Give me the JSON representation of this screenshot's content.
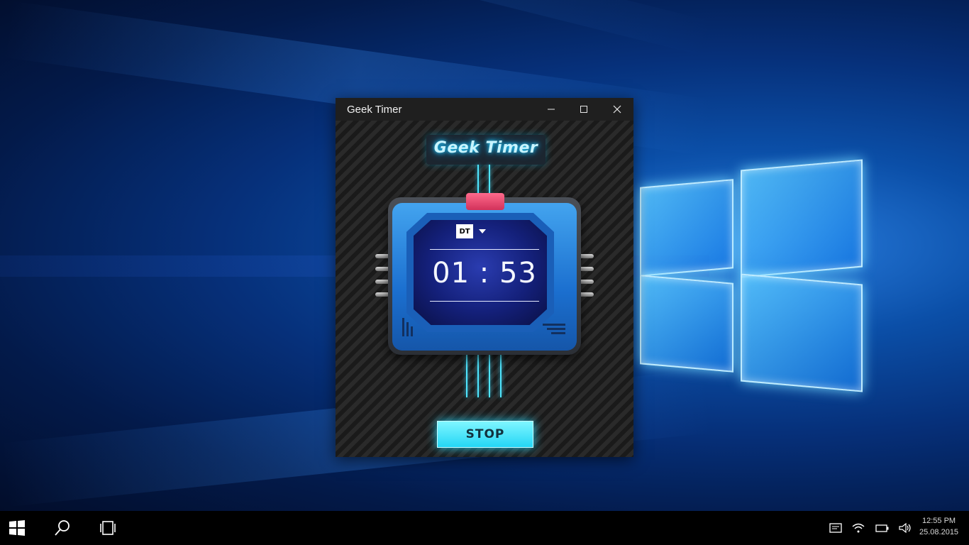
{
  "window": {
    "title": "Geek Timer",
    "minimize_label": "Minimize",
    "maximize_label": "Maximize",
    "close_label": "Close"
  },
  "app": {
    "logo_text": "Geek Timer",
    "profile_badge": "DT",
    "timer_value": "01 : 53",
    "stop_label": "STOP"
  },
  "taskbar": {
    "icons": [
      "windows-start-icon",
      "search-icon",
      "task-view-icon"
    ],
    "tray_icons": [
      "action-center-icon",
      "wifi-icon",
      "battery-icon",
      "volume-icon"
    ],
    "clock_time": "12:55 PM",
    "clock_date": "25.08.2015"
  },
  "colors": {
    "accent": "#29d3ff",
    "device_blue": "#1b6fcf",
    "stop_button": "#24d6f5"
  }
}
